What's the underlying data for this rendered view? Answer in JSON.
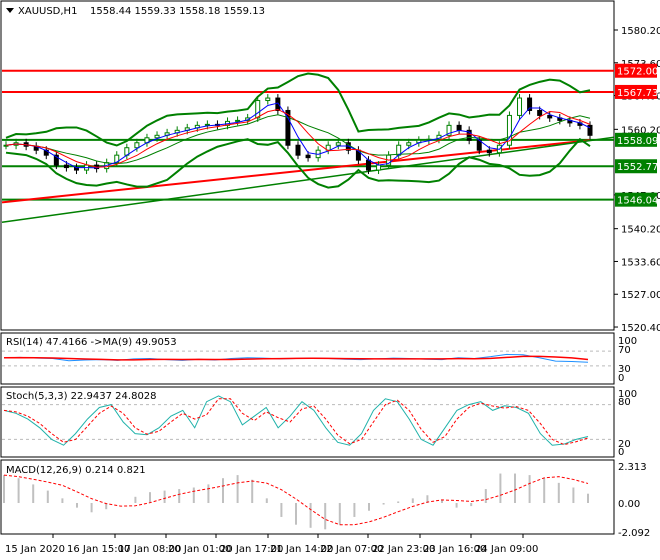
{
  "header": {
    "symbol": "XAUUSD,H1",
    "ohlc": "1558.44 1559.33 1558.18 1559.13"
  },
  "colors": {
    "bull": "#008000",
    "bear": "#000000",
    "resistance": "#ff0000",
    "support": "#008000",
    "rsi": "#1e90ff",
    "signal": "#ff0000",
    "stoch": "#20b2aa"
  },
  "price_axis": {
    "ticks": [
      "1580.20",
      "1573.60",
      "1567.00",
      "1560.20",
      "1547.00",
      "1540.20",
      "1533.60",
      "1527.00",
      "1520.40"
    ]
  },
  "levels": [
    {
      "label": "1572.00",
      "value": 1572.0,
      "type": "resistance"
    },
    {
      "label": "1567.73",
      "value": 1567.73,
      "type": "resistance"
    },
    {
      "label": "1558.09",
      "value": 1558.09,
      "type": "support"
    },
    {
      "label": "1552.77",
      "value": 1552.77,
      "type": "support"
    },
    {
      "label": "1546.04",
      "value": 1546.04,
      "type": "support"
    }
  ],
  "rsi": {
    "label": "RSI(14) 47.4166  ->MA(9) 49.9053",
    "ticks": [
      "100",
      "70",
      "30",
      "0"
    ]
  },
  "stoch": {
    "label": "Stoch(5,3,3) 22.9437 24.8028",
    "ticks": [
      "100",
      "80",
      "20",
      "0"
    ]
  },
  "macd": {
    "label": "MACD(12,26,9) 0.214 0.821",
    "ticks": [
      "2.313",
      "0.00",
      "-2.092"
    ]
  },
  "time_axis": [
    "15 Jan 2020",
    "16 Jan 15:00",
    "17 Jan 08:00",
    "20 Jan 01:00",
    "20 Jan 17:00",
    "21 Jan 14:00",
    "22 Jan 07:00",
    "22 Jan 23:00",
    "23 Jan 16:00",
    "24 Jan 09:00"
  ],
  "chart_data": {
    "type": "candlestick",
    "closes": [
      1557,
      1557.5,
      1556.8,
      1556,
      1555,
      1553,
      1552.5,
      1552,
      1553,
      1552.3,
      1553.5,
      1555,
      1556.5,
      1557.5,
      1558.5,
      1559,
      1559.5,
      1560,
      1560.5,
      1561,
      1561.2,
      1561,
      1561.8,
      1562,
      1562.5,
      1566,
      1566.5,
      1564,
      1557,
      1555,
      1554.5,
      1556,
      1557,
      1557.5,
      1556,
      1554,
      1552,
      1553,
      1555,
      1557,
      1557.5,
      1558,
      1558.2,
      1559,
      1561,
      1560,
      1558,
      1556,
      1555.5,
      1557,
      1563,
      1566.5,
      1564,
      1563,
      1562.5,
      1562,
      1561.5,
      1561,
      1559
    ],
    "ma_long_red": [
      1545.5,
      1558
    ],
    "ma_long_green": [
      1541.5,
      1558.6
    ],
    "rsi_values": [
      52,
      53,
      51,
      50,
      44,
      46,
      47,
      45,
      49,
      50,
      47,
      45,
      48,
      46,
      50,
      52,
      51,
      49,
      50,
      51,
      50,
      48,
      47,
      49,
      51,
      50,
      48,
      47,
      52,
      50,
      55,
      61,
      60,
      52,
      43,
      42,
      40
    ],
    "stoch_k": [
      70,
      65,
      55,
      40,
      20,
      10,
      30,
      55,
      75,
      80,
      50,
      30,
      28,
      40,
      60,
      70,
      40,
      85,
      95,
      85,
      45,
      60,
      75,
      40,
      60,
      85,
      70,
      40,
      15,
      10,
      30,
      70,
      90,
      85,
      55,
      20,
      10,
      40,
      70,
      80,
      85,
      70,
      78,
      75,
      65,
      30,
      10,
      12,
      20,
      25
    ],
    "macd_hist": [
      1.8,
      1.6,
      1.2,
      0.8,
      0.3,
      -0.3,
      -0.6,
      -0.4,
      0,
      0.4,
      0.7,
      0.8,
      0.9,
      1.0,
      1.2,
      1.6,
      1.8,
      1.5,
      0.3,
      -0.9,
      -1.4,
      -1.6,
      -1.7,
      -1.4,
      -0.9,
      -0.5,
      -0.1,
      0.1,
      0.3,
      0.5,
      0.2,
      -0.3,
      -0.2,
      0.9,
      1.9,
      1.9,
      1.8,
      1.6,
      1.3,
      1.0,
      0.6
    ]
  }
}
